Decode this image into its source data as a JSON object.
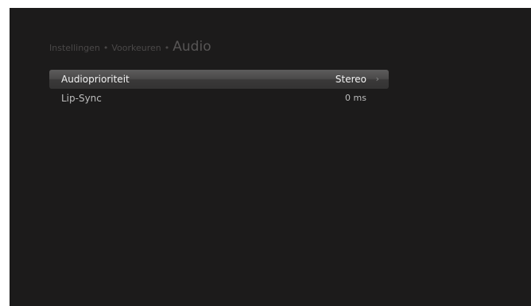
{
  "breadcrumb": {
    "level1": "Instellingen",
    "level2": "Voorkeuren",
    "current": "Audio",
    "separator": "•"
  },
  "menu": {
    "items": [
      {
        "label": "Audioprioriteit",
        "value": "Stereo",
        "selected": true
      },
      {
        "label": "Lip-Sync",
        "value": "0 ms",
        "selected": false
      }
    ]
  },
  "colors": {
    "background": "#1c1b1b",
    "highlight": "#4a4949",
    "text": "#bdbdbd",
    "breadcrumb": "#4a4848"
  },
  "icons": {
    "chevron": "chevron-right-icon"
  }
}
